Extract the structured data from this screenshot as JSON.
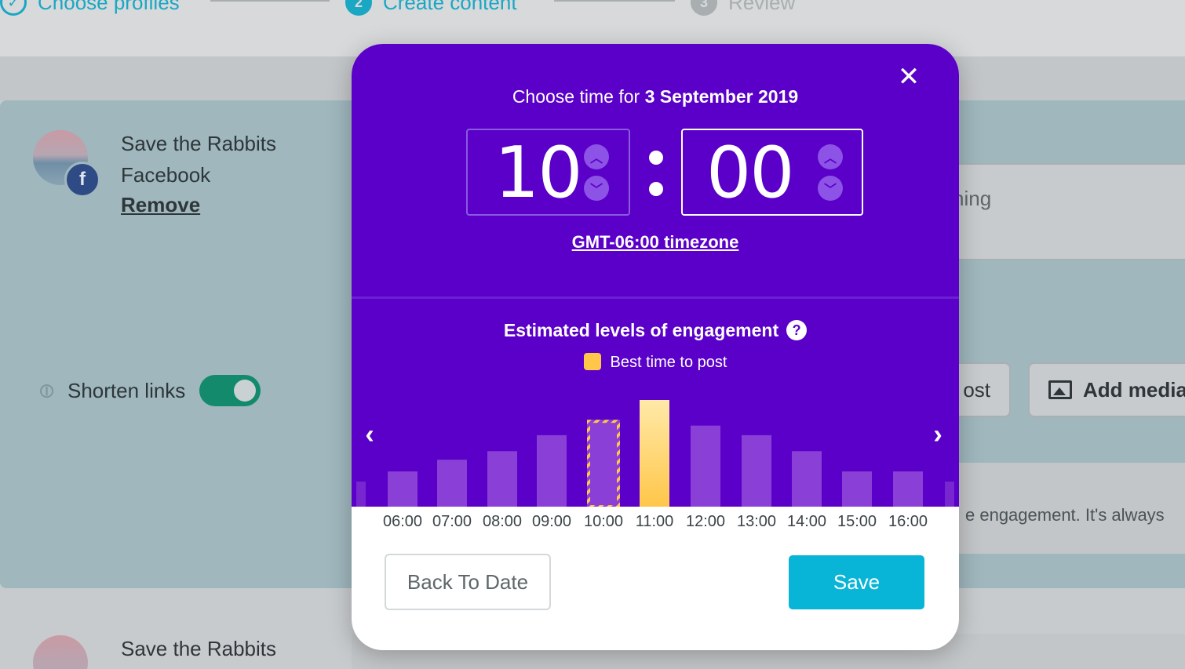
{
  "stepper": {
    "steps": [
      {
        "num": "✓",
        "label": "Choose profiles"
      },
      {
        "num": "2",
        "label": "Create content"
      },
      {
        "num": "3",
        "label": "Review"
      }
    ]
  },
  "profile": {
    "name": "Save the Rabbits",
    "network": "Facebook",
    "network_badge": "f",
    "remove_label": "Remove",
    "shorten_links_label": "Shorten links",
    "shorten_links_on": true
  },
  "background": {
    "input_fragment": "ning",
    "post_button_fragment": "ost",
    "add_media_label": "Add media",
    "notice_fragment": "e engagement. It's always"
  },
  "profile2": {
    "name": "Save the Rabbits"
  },
  "modal": {
    "close_icon": "close-icon",
    "title_prefix": "Choose time for ",
    "title_date": "3 September 2019",
    "hour": "10",
    "minute": "00",
    "colon": ":",
    "timezone_link": "GMT-06:00 timezone",
    "engagement_title": "Estimated levels of engagement",
    "help_icon": "?",
    "legend_label": "Best time to post",
    "prev_icon": "‹",
    "next_icon": "›",
    "back_label": "Back To Date",
    "save_label": "Save",
    "colors": {
      "purple": "#5a00c8",
      "bar": "#8a3fd6",
      "best": "#ffc64a",
      "save": "#08b5d6"
    }
  },
  "chart_data": {
    "type": "bar",
    "categories": [
      "06:00",
      "07:00",
      "08:00",
      "09:00",
      "10:00",
      "11:00",
      "12:00",
      "13:00",
      "14:00",
      "15:00",
      "16:00"
    ],
    "values": [
      33,
      44,
      52,
      67,
      80,
      100,
      76,
      67,
      52,
      33,
      33
    ],
    "selected": "10:00",
    "best": "11:00",
    "ylim": [
      0,
      100
    ]
  }
}
